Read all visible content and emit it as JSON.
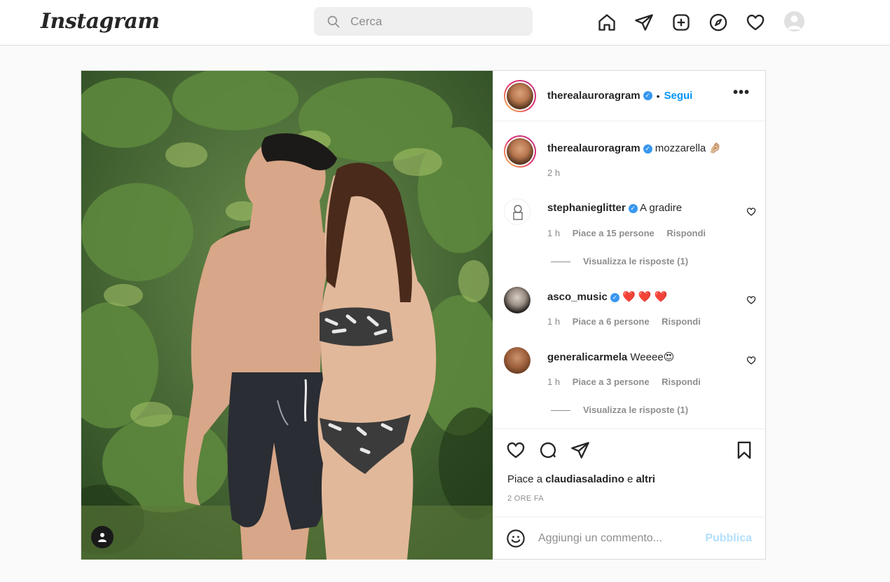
{
  "header": {
    "logo": "Instagram",
    "search_placeholder": "Cerca"
  },
  "post": {
    "author": "therealauroragram",
    "follow_label": "Segui",
    "separator": "•",
    "more": "•••",
    "caption": {
      "username": "therealauroragram",
      "text": "mozzarella 🤌🏼",
      "time": "2 h"
    },
    "comments": [
      {
        "username": "stephanieglitter",
        "verified": true,
        "text": "A gradire",
        "time": "1 h",
        "likes": "Piace a 15 persone",
        "reply": "Rispondi",
        "view_replies": "Visualizza le risposte (1)"
      },
      {
        "username": "asco_music",
        "verified": true,
        "text": "❤️ ❤️ ❤️",
        "time": "1 h",
        "likes": "Piace a 6 persone",
        "reply": "Rispondi"
      },
      {
        "username": "generalicarmela",
        "verified": false,
        "text": "Weeee😍",
        "time": "1 h",
        "likes": "Piace a 3 persone",
        "reply": "Rispondi",
        "view_replies": "Visualizza le risposte (1)"
      }
    ],
    "liked_by_prefix": "Piace a",
    "liked_by_user": "claudiasaladino",
    "liked_by_and": "e",
    "liked_by_others": "altri",
    "posted_time": "2 ORE FA",
    "add_comment_placeholder": "Aggiungi un commento...",
    "publish_label": "Pubblica"
  },
  "colors": {
    "accent": "#0095f6",
    "verified": "#3897f0",
    "publish_disabled": "#b2dffc"
  }
}
